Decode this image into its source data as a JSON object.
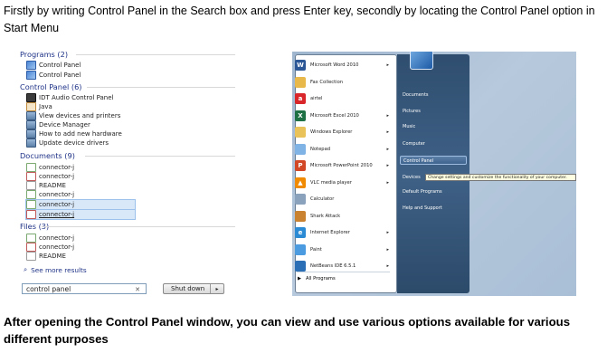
{
  "intro_text": "Firstly by writing Control Panel in the Search box and press Enter key, secondly by locating the Control Panel option in Start Menu",
  "outro_text": "After opening the Control Panel window, you can view and use various options available for various different purposes",
  "search_results": {
    "programs_header": "Programs (2)",
    "programs": [
      "Control Panel",
      "Control Panel"
    ],
    "control_panel_header": "Control Panel (6)",
    "control_panel_items": [
      "IDT Audio Control Panel",
      "Java",
      "View devices and printers",
      "Device Manager",
      "How to add new hardware",
      "Update device drivers"
    ],
    "documents_header": "Documents (9)",
    "documents": [
      "connector-j",
      "connector-j",
      "README",
      "connector-j",
      "connector-j",
      "connector-j"
    ],
    "files_header": "Files (3)",
    "files": [
      "connector-j",
      "connector-j",
      "README"
    ],
    "see_more": "See more results",
    "search_value": "control panel",
    "shutdown_label": "Shut down"
  },
  "start_menu": {
    "apps": [
      {
        "label": "Microsoft Word 2010",
        "icon": "word-icon",
        "color": "#2b5797",
        "glyph": "W",
        "arrow": true
      },
      {
        "label": "Fax Collection",
        "icon": "folder-icon",
        "color": "#e8b84a",
        "glyph": "",
        "arrow": false
      },
      {
        "label": "airtel",
        "icon": "airtel-icon",
        "color": "#d8262b",
        "glyph": "a",
        "arrow": false
      },
      {
        "label": "Microsoft Excel 2010",
        "icon": "excel-icon",
        "color": "#1e7145",
        "glyph": "X",
        "arrow": true
      },
      {
        "label": "Windows Explorer",
        "icon": "explorer-icon",
        "color": "#e9c25a",
        "glyph": "",
        "arrow": true
      },
      {
        "label": "Notepad",
        "icon": "notepad-icon",
        "color": "#7fb2e5",
        "glyph": "",
        "arrow": true
      },
      {
        "label": "Microsoft PowerPoint 2010",
        "icon": "powerpoint-icon",
        "color": "#d24726",
        "glyph": "P",
        "arrow": true
      },
      {
        "label": "VLC media player",
        "icon": "vlc-icon",
        "color": "#f08a00",
        "glyph": "▲",
        "arrow": true
      },
      {
        "label": "Calculator",
        "icon": "calculator-icon",
        "color": "#8aa2bb",
        "glyph": "",
        "arrow": false
      },
      {
        "label": "Shark Attack",
        "icon": "shark-icon",
        "color": "#c9822f",
        "glyph": "",
        "arrow": false
      },
      {
        "label": "Internet Explorer",
        "icon": "ie-icon",
        "color": "#2a8ad4",
        "glyph": "e",
        "arrow": true
      },
      {
        "label": "Paint",
        "icon": "paint-icon",
        "color": "#4a9be0",
        "glyph": "",
        "arrow": true
      },
      {
        "label": "NetBeans IDE 6.5.1",
        "icon": "netbeans-icon",
        "color": "#2a6fb5",
        "glyph": "",
        "arrow": true
      }
    ],
    "all_programs": "All Programs",
    "right_items": [
      "Documents",
      "Pictures",
      "Music",
      "Computer",
      "Control Panel",
      "Devices",
      "Default Programs",
      "Help and Support"
    ],
    "tooltip": "Change settings and customize the functionality of your computer."
  }
}
